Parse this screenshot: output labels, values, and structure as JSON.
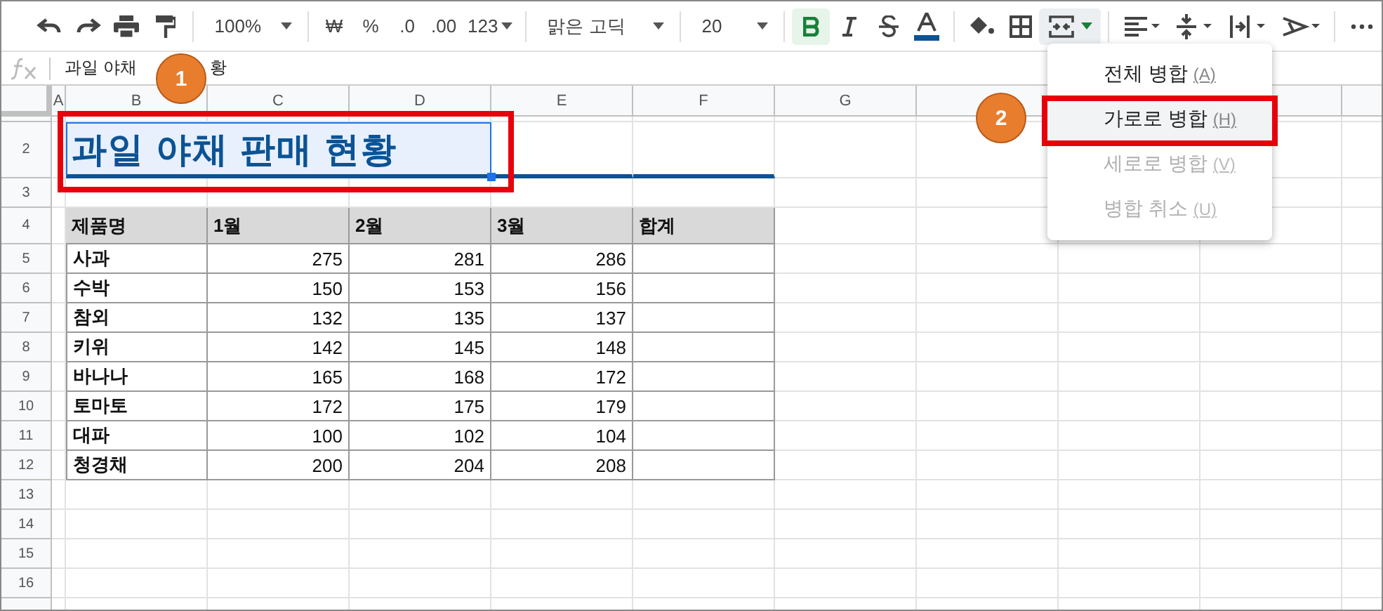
{
  "toolbar": {
    "zoom": "100%",
    "currency": "₩",
    "percent": "%",
    "decrease_decimal": ".0",
    "increase_decimal": ".00",
    "number_format": "123",
    "font": "맑은 고딕",
    "font_size": "20",
    "bold": true,
    "merge_menu_open": true
  },
  "formula_bar": {
    "visible_start": "과일 야채",
    "visible_end": "황"
  },
  "columns": [
    "A",
    "B",
    "C",
    "D",
    "E",
    "F",
    "G"
  ],
  "row_numbers": [
    "2",
    "3",
    "4",
    "5",
    "6",
    "7",
    "8",
    "9",
    "10",
    "11",
    "12",
    "13",
    "14",
    "15",
    "16"
  ],
  "title": "과일 야채 판매 현황",
  "table": {
    "header": [
      "제품명",
      "1월",
      "2월",
      "3월",
      "합계"
    ],
    "rows": [
      [
        "사과",
        "275",
        "281",
        "286"
      ],
      [
        "수박",
        "150",
        "153",
        "156"
      ],
      [
        "참외",
        "132",
        "135",
        "137"
      ],
      [
        "키위",
        "142",
        "145",
        "148"
      ],
      [
        "바나나",
        "165",
        "168",
        "172"
      ],
      [
        "토마토",
        "172",
        "175",
        "179"
      ],
      [
        "대파",
        "100",
        "102",
        "104"
      ],
      [
        "청경채",
        "200",
        "204",
        "208"
      ]
    ]
  },
  "merge_menu": [
    {
      "label": "전체 병합",
      "shortcut": "(A)",
      "disabled": false,
      "selected": false
    },
    {
      "label": "가로로 병합",
      "shortcut": "(H)",
      "disabled": false,
      "selected": true
    },
    {
      "label": "세로로 병합",
      "shortcut": "(V)",
      "disabled": true,
      "selected": false
    },
    {
      "label": "병합 취소",
      "shortcut": "(U)",
      "disabled": true,
      "selected": false
    }
  ],
  "callouts": [
    "1",
    "2"
  ]
}
